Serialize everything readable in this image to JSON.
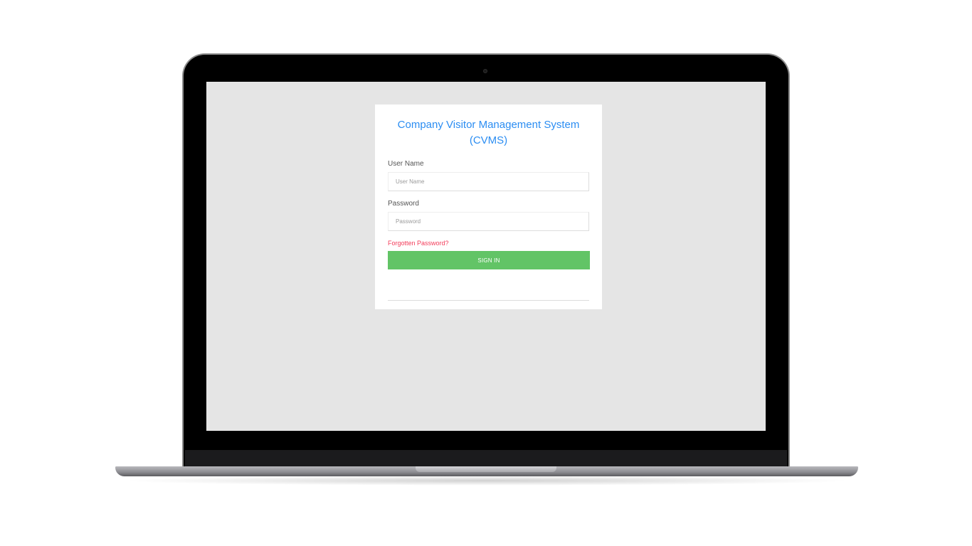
{
  "login": {
    "title": "Company Visitor Management System (CVMS)",
    "username_label": "User Name",
    "username_placeholder": "User Name",
    "password_label": "Password",
    "password_placeholder": "Password",
    "forgot_link": "Forgotten Password?",
    "signin_label": "SIGN IN"
  },
  "colors": {
    "title": "#2b8df2",
    "link": "#f33c5a",
    "button": "#62c466",
    "screen_bg": "#e5e5e5"
  }
}
